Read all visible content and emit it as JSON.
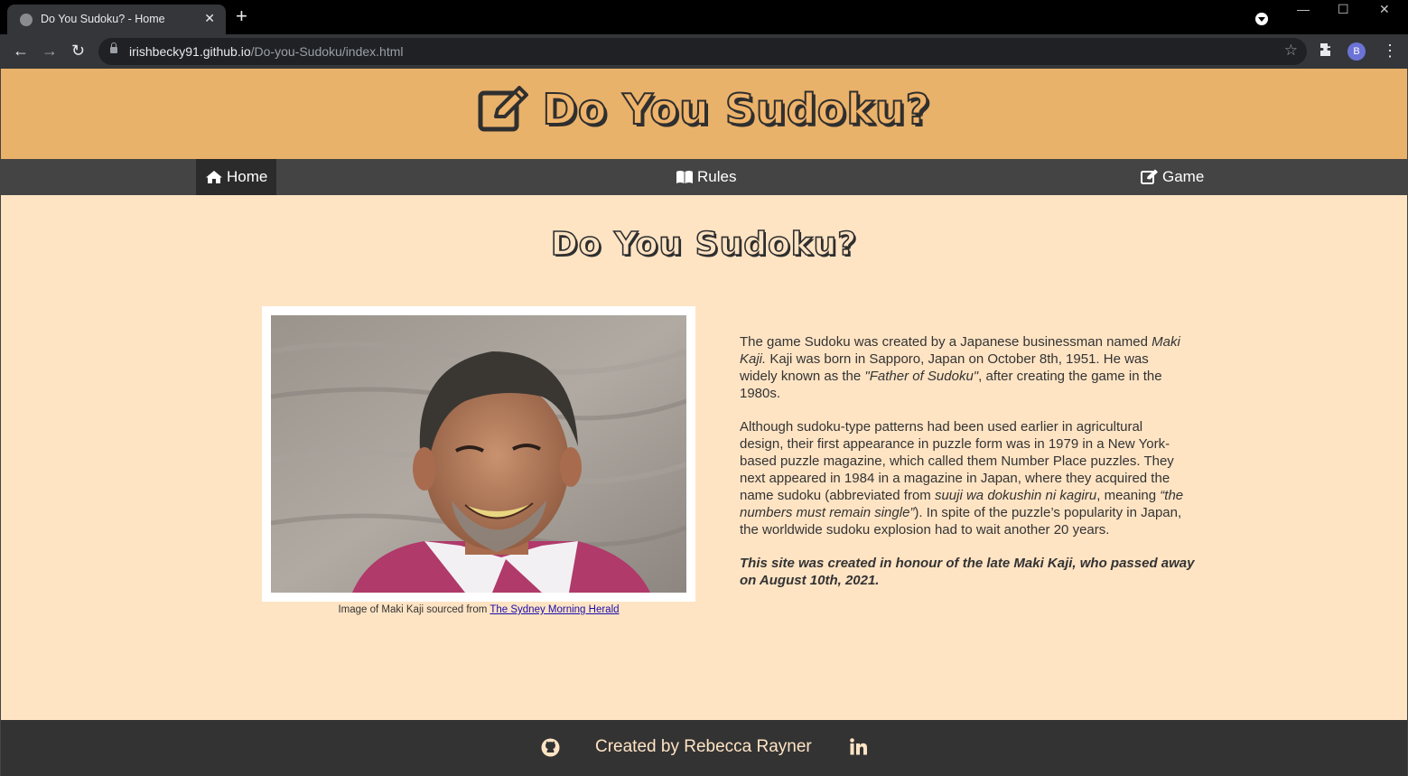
{
  "browser": {
    "tab_title": "Do You Sudoku? - Home",
    "url_host": "irishbecky91.github.io",
    "url_path": "/Do-you-Sudoku/index.html",
    "profile_initial": "B"
  },
  "site": {
    "banner_title": "Do You Sudoku?",
    "nav": {
      "home": "Home",
      "rules": "Rules",
      "game": "Game"
    },
    "heading": "Do You Sudoku?",
    "caption_prefix": "Image of Maki Kaji sourced from ",
    "caption_link": "The Sydney Morning Herald",
    "intro_1": "The game Sudoku was created by a Japanese businessman named ",
    "intro_name": "Maki Kaji.",
    "intro_2": " Kaji was born in Sapporo, Japan on October 8th, 1951. He was widely known as the ",
    "intro_father": "\"Father of Sudoku\"",
    "intro_3": ", after creating the game in the 1980s.",
    "history_1": "Although sudoku-type patterns had been used earlier in agricultural design, their first appearance in puzzle form was in 1979 in a New York-based puzzle magazine, which called them Number Place puzzles. They next appeared in 1984 in a magazine in Japan, where they acquired the name sudoku (abbreviated from ",
    "history_jp": "suuji wa dokushin ni kagiru",
    "history_2": ", meaning ",
    "history_meaning": "“the numbers must remain single”",
    "history_3": "). In spite of the puzzle’s popularity in Japan, the worldwide sudoku explosion had to wait another 20 years.",
    "tribute": "This site was created in honour of the late Maki Kaji, who passed away on August 10th, 2021.",
    "footer_text": "Created by Rebecca Rayner"
  },
  "colors": {
    "banner": "#e9b26a",
    "page_bg": "#ffe4c4",
    "nav_bg": "#444444",
    "footer_bg": "#333333"
  }
}
